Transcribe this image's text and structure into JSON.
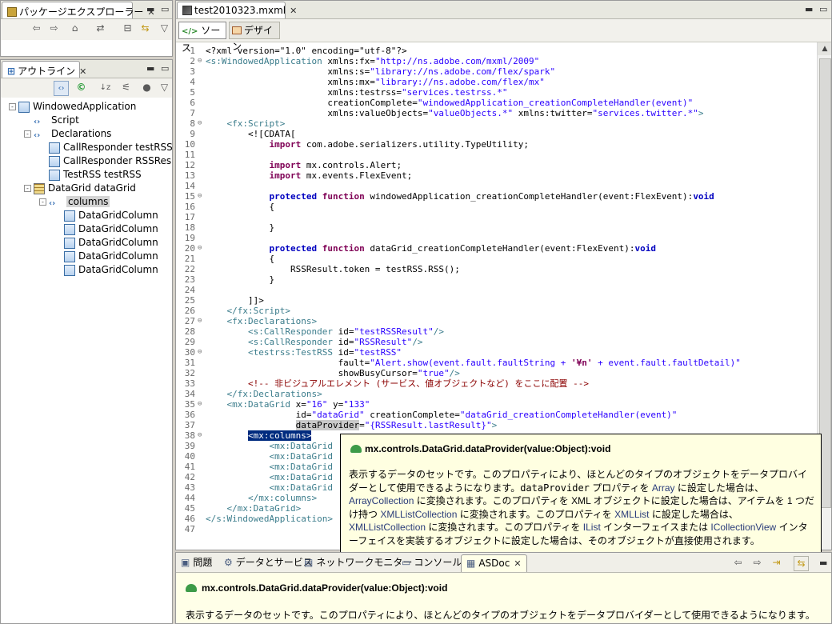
{
  "package_explorer": {
    "tab_label": "パッケージエクスプローラー"
  },
  "outline": {
    "tab_label": "アウトライン",
    "toolbar_icons": [
      "tag-toggle-icon",
      "refresh-icon",
      "sort-icon",
      "filter-icon",
      "dot-icon",
      "view-menu-icon"
    ],
    "tree": [
      {
        "label": "WindowedApplication",
        "depth": 0,
        "toggle": "-",
        "icon": "component"
      },
      {
        "label": "Script",
        "depth": 1,
        "toggle": "",
        "icon": "tag"
      },
      {
        "label": "Declarations",
        "depth": 1,
        "toggle": "-",
        "icon": "tag"
      },
      {
        "label": "CallResponder testRSSR",
        "depth": 2,
        "toggle": "",
        "icon": "component"
      },
      {
        "label": "CallResponder RSSResul",
        "depth": 2,
        "toggle": "",
        "icon": "component"
      },
      {
        "label": "TestRSS testRSS",
        "depth": 2,
        "toggle": "",
        "icon": "component"
      },
      {
        "label": "DataGrid dataGrid",
        "depth": 1,
        "toggle": "-",
        "icon": "grid"
      },
      {
        "label": "columns",
        "depth": 2,
        "toggle": "-",
        "icon": "tag",
        "selected": true
      },
      {
        "label": "DataGridColumn",
        "depth": 3,
        "toggle": "",
        "icon": "component"
      },
      {
        "label": "DataGridColumn",
        "depth": 3,
        "toggle": "",
        "icon": "component"
      },
      {
        "label": "DataGridColumn",
        "depth": 3,
        "toggle": "",
        "icon": "component"
      },
      {
        "label": "DataGridColumn",
        "depth": 3,
        "toggle": "",
        "icon": "component"
      },
      {
        "label": "DataGridColumn",
        "depth": 3,
        "toggle": "",
        "icon": "component"
      }
    ]
  },
  "editor": {
    "tab_label": "test2010323.mxml",
    "source_button": "ソース",
    "design_button": "デザイン",
    "lines": [
      {
        "n": "1",
        "f": "",
        "segs": [
          [
            "",
            "<?xml version=\"1.0\" encoding=\"utf-8\"?>"
          ]
        ]
      },
      {
        "n": "2",
        "f": "⊖",
        "segs": [
          [
            "tg",
            "<s:WindowedApplication "
          ],
          [
            "",
            "xmlns:fx="
          ],
          [
            "av",
            "\"http://ns.adobe.com/mxml/2009\""
          ]
        ]
      },
      {
        "n": "3",
        "f": "",
        "segs": [
          [
            "",
            "                       xmlns:s="
          ],
          [
            "av",
            "\"library://ns.adobe.com/flex/spark\""
          ]
        ]
      },
      {
        "n": "4",
        "f": "",
        "segs": [
          [
            "",
            "                       xmlns:mx="
          ],
          [
            "av",
            "\"library://ns.adobe.com/flex/mx\""
          ]
        ]
      },
      {
        "n": "5",
        "f": "",
        "segs": [
          [
            "",
            "                       xmlns:testrss="
          ],
          [
            "av",
            "\"services.testrss.*\""
          ]
        ]
      },
      {
        "n": "6",
        "f": "",
        "segs": [
          [
            "",
            "                       creationComplete="
          ],
          [
            "av",
            "\"windowedApplication_creationCompleteHandler(event)\""
          ]
        ]
      },
      {
        "n": "7",
        "f": "",
        "segs": [
          [
            "",
            "                       xmlns:valueObjects="
          ],
          [
            "av",
            "\"valueObjects.*\""
          ],
          [
            "",
            " xmlns:twitter="
          ],
          [
            "av",
            "\"services.twitter.*\""
          ],
          [
            "tg",
            ">"
          ]
        ]
      },
      {
        "n": "8",
        "f": "⊖",
        "segs": [
          [
            "tg",
            "    <fx:Script>"
          ]
        ]
      },
      {
        "n": "9",
        "f": "",
        "segs": [
          [
            "",
            "        <![CDATA["
          ]
        ]
      },
      {
        "n": "10",
        "f": "",
        "segs": [
          [
            "",
            "            "
          ],
          [
            "kw",
            "import"
          ],
          [
            "",
            " com.adobe.serializers.utility.TypeUtility;"
          ]
        ]
      },
      {
        "n": "11",
        "f": "",
        "segs": [
          [
            "",
            ""
          ]
        ]
      },
      {
        "n": "12",
        "f": "",
        "segs": [
          [
            "",
            "            "
          ],
          [
            "kw",
            "import"
          ],
          [
            "",
            " mx.controls.Alert;"
          ]
        ]
      },
      {
        "n": "13",
        "f": "",
        "segs": [
          [
            "",
            "            "
          ],
          [
            "kw",
            "import"
          ],
          [
            "",
            " mx.events.FlexEvent;"
          ]
        ]
      },
      {
        "n": "14",
        "f": "",
        "segs": [
          [
            "",
            ""
          ]
        ]
      },
      {
        "n": "15",
        "f": "⊖",
        "segs": [
          [
            "",
            "            "
          ],
          [
            "kb",
            "protected"
          ],
          [
            "",
            " "
          ],
          [
            "kw",
            "function"
          ],
          [
            "",
            " windowedApplication_creationCompleteHandler(event:FlexEvent):"
          ],
          [
            "kb",
            "void"
          ]
        ]
      },
      {
        "n": "16",
        "f": "",
        "segs": [
          [
            "",
            "            {"
          ]
        ]
      },
      {
        "n": "17",
        "f": "",
        "segs": [
          [
            "",
            ""
          ]
        ]
      },
      {
        "n": "18",
        "f": "",
        "segs": [
          [
            "",
            "            }"
          ]
        ]
      },
      {
        "n": "19",
        "f": "",
        "segs": [
          [
            "",
            ""
          ]
        ]
      },
      {
        "n": "20",
        "f": "⊖",
        "segs": [
          [
            "",
            "            "
          ],
          [
            "kb",
            "protected"
          ],
          [
            "",
            " "
          ],
          [
            "kw",
            "function"
          ],
          [
            "",
            " dataGrid_creationCompleteHandler(event:FlexEvent):"
          ],
          [
            "kb",
            "void"
          ]
        ]
      },
      {
        "n": "21",
        "f": "",
        "segs": [
          [
            "",
            "            {"
          ]
        ]
      },
      {
        "n": "22",
        "f": "",
        "segs": [
          [
            "",
            "                RSSResult.token = testRSS.RSS();"
          ]
        ]
      },
      {
        "n": "23",
        "f": "",
        "segs": [
          [
            "",
            "            }"
          ]
        ]
      },
      {
        "n": "24",
        "f": "",
        "segs": [
          [
            "",
            ""
          ]
        ]
      },
      {
        "n": "25",
        "f": "",
        "segs": [
          [
            "",
            "        ]]>"
          ]
        ]
      },
      {
        "n": "26",
        "f": "",
        "segs": [
          [
            "tg",
            "    </fx:Script>"
          ]
        ]
      },
      {
        "n": "27",
        "f": "⊖",
        "segs": [
          [
            "tg",
            "    <fx:Declarations>"
          ]
        ]
      },
      {
        "n": "28",
        "f": "",
        "segs": [
          [
            "tg",
            "        <s:CallResponder "
          ],
          [
            "",
            "id="
          ],
          [
            "av",
            "\"testRSSResult\""
          ],
          [
            "tg",
            "/>"
          ]
        ]
      },
      {
        "n": "29",
        "f": "",
        "segs": [
          [
            "tg",
            "        <s:CallResponder "
          ],
          [
            "",
            "id="
          ],
          [
            "av",
            "\"RSSResult\""
          ],
          [
            "tg",
            "/>"
          ]
        ]
      },
      {
        "n": "30",
        "f": "⊖",
        "segs": [
          [
            "tg",
            "        <testrss:TestRSS "
          ],
          [
            "",
            "id="
          ],
          [
            "av",
            "\"testRSS\""
          ]
        ]
      },
      {
        "n": "31",
        "f": "",
        "segs": [
          [
            "",
            "                         fault="
          ],
          [
            "av",
            "\"Alert.show(event.fault.faultString + "
          ],
          [
            "kw",
            "'¥n'"
          ],
          [
            "av",
            " + event.fault.faultDetail)\""
          ]
        ]
      },
      {
        "n": "32",
        "f": "",
        "segs": [
          [
            "",
            "                         showBusyCursor="
          ],
          [
            "av",
            "\"true\""
          ],
          [
            "tg",
            "/>"
          ]
        ]
      },
      {
        "n": "33",
        "f": "",
        "segs": [
          [
            "cm",
            "        <!-- 非ビジュアルエレメント (サービス、値オブジェクトなど) をここに配置 -->"
          ]
        ]
      },
      {
        "n": "34",
        "f": "",
        "segs": [
          [
            "tg",
            "    </fx:Declarations>"
          ]
        ]
      },
      {
        "n": "35",
        "f": "⊖",
        "segs": [
          [
            "tg",
            "    <mx:DataGrid "
          ],
          [
            "",
            "x="
          ],
          [
            "av",
            "\"16\""
          ],
          [
            "",
            " y="
          ],
          [
            "av",
            "\"133\""
          ]
        ]
      },
      {
        "n": "36",
        "f": "",
        "segs": [
          [
            "",
            "                 id="
          ],
          [
            "av",
            "\"dataGrid\""
          ],
          [
            "",
            " creationComplete="
          ],
          [
            "av",
            "\"dataGrid_creationCompleteHandler(event)\""
          ]
        ]
      },
      {
        "n": "37",
        "f": "",
        "segs": [
          [
            "",
            "                 "
          ],
          [
            "hl",
            "dataProvider"
          ],
          [
            "",
            "="
          ],
          [
            "av",
            "\"{RSSResult.lastResult}\""
          ],
          [
            "tg",
            ">"
          ]
        ]
      },
      {
        "n": "38",
        "f": "⊖",
        "segs": [
          [
            "",
            "        "
          ],
          [
            "sel",
            "<mx:columns>"
          ]
        ]
      },
      {
        "n": "39",
        "f": "",
        "segs": [
          [
            "tg",
            "            <mx:DataGrid"
          ]
        ]
      },
      {
        "n": "40",
        "f": "",
        "segs": [
          [
            "tg",
            "            <mx:DataGrid"
          ]
        ]
      },
      {
        "n": "41",
        "f": "",
        "segs": [
          [
            "tg",
            "            <mx:DataGrid"
          ]
        ]
      },
      {
        "n": "42",
        "f": "",
        "segs": [
          [
            "tg",
            "            <mx:DataGrid"
          ]
        ]
      },
      {
        "n": "43",
        "f": "",
        "segs": [
          [
            "tg",
            "            <mx:DataGrid"
          ]
        ]
      },
      {
        "n": "44",
        "f": "",
        "segs": [
          [
            "tg",
            "        </mx:columns>"
          ]
        ]
      },
      {
        "n": "45",
        "f": "",
        "segs": [
          [
            "tg",
            "    </mx:DataGrid>"
          ]
        ]
      },
      {
        "n": "46",
        "f": "",
        "segs": [
          [
            "tg",
            "</s:WindowedApplication>"
          ]
        ]
      },
      {
        "n": "47",
        "f": "",
        "segs": [
          [
            "",
            ""
          ]
        ]
      }
    ]
  },
  "tooltip": {
    "title": "mx.controls.DataGrid.dataProvider(value:Object):void",
    "body_parts": [
      [
        "",
        "表示するデータのセットです。このプロパティにより、ほとんどのタイプのオブジェクトをデータプロバイダーとして使用できるようになります。"
      ],
      [
        "mono",
        "dataProvider"
      ],
      [
        "",
        " プロパティを "
      ],
      [
        "c-link",
        "Array"
      ],
      [
        "",
        " に設定した場合は、"
      ],
      [
        "c-link",
        "ArrayCollection"
      ],
      [
        "",
        " に変換されます。このプロパティを XML オブジェクトに設定した場合は、アイテムを 1 つだけ持つ "
      ],
      [
        "c-link",
        "XMLListCollection"
      ],
      [
        "",
        " に変換されます。このプロパティを "
      ],
      [
        "c-link",
        "XMLList"
      ],
      [
        "",
        " に設定した場合は、"
      ],
      [
        "c-link",
        "XMLListCollection"
      ],
      [
        "",
        " に変換されます。このプロパティを "
      ],
      [
        "c-link",
        "IList"
      ],
      [
        "",
        " インターフェイスまたは "
      ],
      [
        "c-link",
        "ICollectionView"
      ],
      [
        "",
        " インターフェイスを実装するオブジェクトに設定した場合は、そのオブジェクトが直接使用されます。"
      ]
    ]
  },
  "bottom_tabs": [
    {
      "label": "問題",
      "icon": "problems-icon"
    },
    {
      "label": "データとサービス",
      "icon": "data-services-icon"
    },
    {
      "label": "ネットワークモニター",
      "icon": "network-monitor-icon"
    },
    {
      "label": "コンソール",
      "icon": "console-icon"
    },
    {
      "label": "ASDoc",
      "icon": "asdoc-icon",
      "active": true
    }
  ],
  "asdoc": {
    "title": "mx.controls.DataGrid.dataProvider(value:Object):void",
    "body": "表示するデータのセットです。このプロパティにより、ほとんどのタイプのオブジェクトをデータプロバイダーとして使用できるようになります。"
  }
}
